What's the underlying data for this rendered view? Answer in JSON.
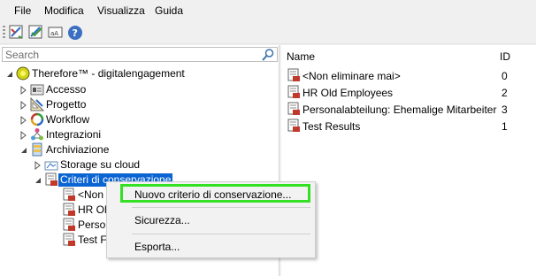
{
  "menubar": {
    "items": [
      "File",
      "Modifica",
      "Visualizza",
      "Guida"
    ]
  },
  "toolbar": {
    "buttons": [
      "designer-icon",
      "designer-check-icon",
      "find-replace-icon",
      "help-icon"
    ]
  },
  "search": {
    "placeholder": "Search"
  },
  "tree": {
    "root": "Therefore™ -  digitalengagement",
    "items": [
      {
        "label": "Accesso",
        "icon": "access-icon"
      },
      {
        "label": "Progetto",
        "icon": "project-icon"
      },
      {
        "label": "Workflow",
        "icon": "workflow-icon"
      },
      {
        "label": "Integrazioni",
        "icon": "integrations-icon"
      },
      {
        "label": "Archiviazione",
        "icon": "archive-icon"
      },
      {
        "label": "Storage su cloud",
        "icon": "cloud-storage-icon"
      },
      {
        "label": "Criteri di conservazione",
        "icon": "retention-policy-icon"
      },
      {
        "label": "<Non",
        "icon": "retention-policy-icon"
      },
      {
        "label": "HR Ol",
        "icon": "retention-policy-icon"
      },
      {
        "label": "Person",
        "icon": "retention-policy-icon"
      },
      {
        "label": "Test F",
        "icon": "retention-policy-icon"
      }
    ]
  },
  "list": {
    "columns": {
      "name": "Name",
      "id": "ID"
    },
    "rows": [
      {
        "name": "<Non eliminare mai>",
        "id": "0"
      },
      {
        "name": "HR Old Employees",
        "id": "2"
      },
      {
        "name": "Personalabteilung: Ehemalige Mitarbeiter",
        "id": "3"
      },
      {
        "name": "Test Results",
        "id": "1"
      }
    ]
  },
  "context_menu": {
    "new_policy": "Nuovo criterio di conservazione...",
    "security": "Sicurezza...",
    "export": "Esporta..."
  },
  "colors": {
    "selection": "#0a64d2",
    "highlight_box": "#33e024"
  }
}
